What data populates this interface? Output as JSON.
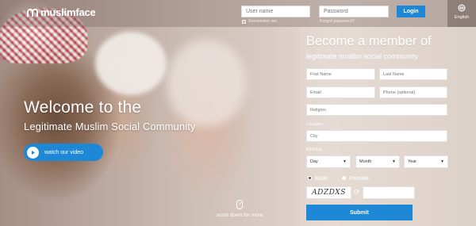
{
  "brand": {
    "name": "muslimface"
  },
  "login": {
    "username_placeholder": "User name",
    "password_placeholder": "Password",
    "remember_label": "Remember me",
    "forgot_label": "Forgot password?",
    "button_label": "Login"
  },
  "language": {
    "label": "English"
  },
  "hero": {
    "title": "Welcome to the",
    "subtitle": "Legitimate Muslim Social Community",
    "video_button": "watch our video",
    "scroll_hint": "scroll down for more"
  },
  "signup": {
    "title": "Become a member of",
    "subtitle": "legitimate muslim social community",
    "first_name": "First Name",
    "last_name": "Last Name",
    "email": "Email",
    "phone": "Phone (optional)",
    "religion": "Religion",
    "location_label": "Location",
    "city": "City",
    "birthday_label": "Birthday",
    "day": "Day",
    "month": "Month",
    "year": "Year",
    "male": "Male",
    "female": "Female",
    "selected_gender": "Male",
    "captcha_text": "ADZDXS",
    "submit": "Submit"
  },
  "colors": {
    "accent": "#1e88d6"
  }
}
